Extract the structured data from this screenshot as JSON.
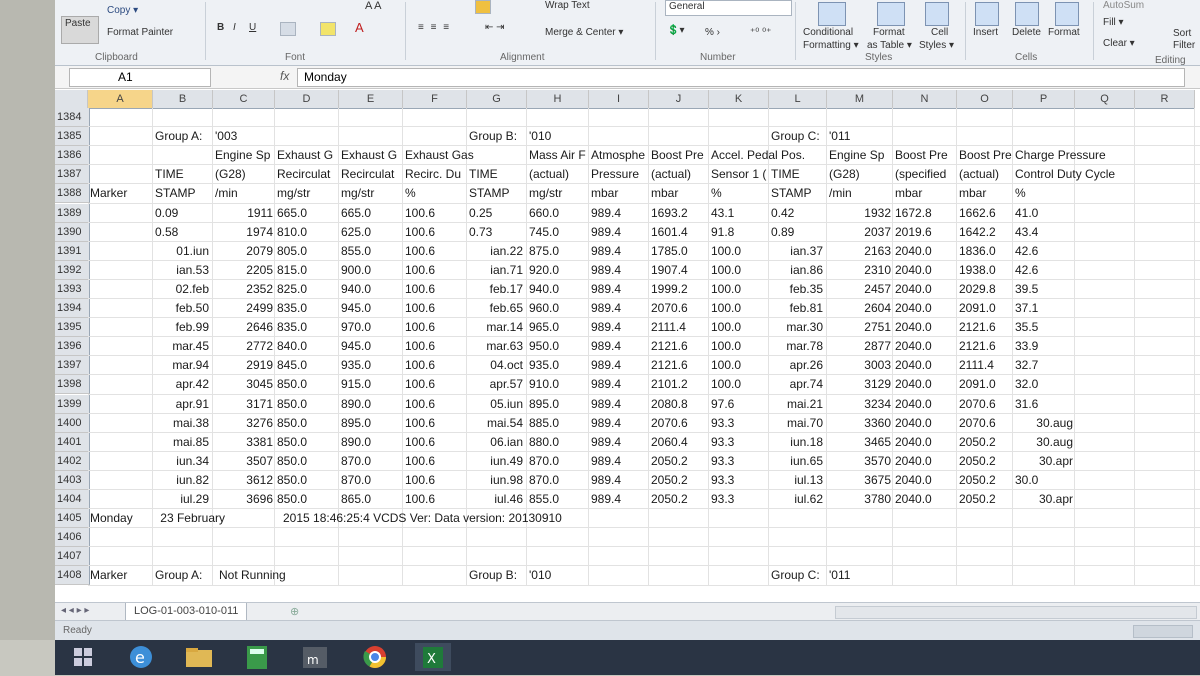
{
  "ribbon": {
    "paste": "Paste",
    "copy": "Copy ▾",
    "format_painter": "Format Painter",
    "clipboard": "Clipboard",
    "font": "Font",
    "alignment": "Alignment",
    "number": "Number",
    "styles": "Styles",
    "cells": "Cells",
    "editing": "Editing",
    "wrap_text": "Wrap Text",
    "merge_center": "Merge & Center ▾",
    "number_format": "General",
    "percent": "% ›",
    "conditional": "Conditional",
    "formatting": "Formatting ▾",
    "format_as": "Format",
    "as_table": "as Table ▾",
    "cell": "Cell",
    "cell_styles": "Styles ▾",
    "insert": "Insert",
    "delete": "Delete",
    "format": "Format",
    "fill": "Fill ▾",
    "clear": "Clear ▾",
    "sort": "Sort",
    "filter": "Filter",
    "autosum": "AutoSum"
  },
  "formula_bar": {
    "name_box": "A1",
    "fx": "fx",
    "value": "Monday"
  },
  "columns": [
    "A",
    "B",
    "C",
    "D",
    "E",
    "F",
    "G",
    "H",
    "I",
    "J",
    "K",
    "L",
    "M",
    "N",
    "O",
    "P",
    "Q",
    "R"
  ],
  "row_numbers": [
    "1384",
    "1385",
    "1386",
    "1387",
    "1388",
    "1389",
    "1390",
    "1391",
    "1392",
    "1393",
    "1394",
    "1395",
    "1396",
    "1397",
    "1398",
    "1399",
    "1400",
    "1401",
    "1402",
    "1403",
    "1404",
    "1405",
    "1406",
    "1407",
    "1408"
  ],
  "group_rows": {
    "groupA": "Group A:",
    "groupA_code": "'003",
    "groupB": "Group B:",
    "groupB_code": "'010",
    "groupC": "Group C:",
    "groupC_code": "'011"
  },
  "headers_1386": [
    "Engine Sp",
    "Exhaust G",
    "Exhaust G",
    "Exhaust Gas",
    "Mass Air F",
    "Atmosphe",
    "Boost Pre",
    "Accel. Pedal Pos.",
    "Engine Sp",
    "Boost Pre",
    "Boost Pre",
    "Charge Pressure"
  ],
  "headers_1387": [
    "TIME",
    "(G28)",
    "Recirculat",
    "Recirculat",
    "Recirc. Du",
    "TIME",
    "(actual)",
    "Pressure",
    "(actual)",
    "Sensor 1 (",
    "TIME",
    "(G28)",
    "(specified",
    "(actual)",
    "Control Duty Cycle"
  ],
  "headers_1388": [
    "Marker",
    "STAMP",
    "/min",
    "mg/str",
    "mg/str",
    "%",
    "STAMP",
    "mg/str",
    "mbar",
    "mbar",
    "%",
    "STAMP",
    "/min",
    "mbar",
    "mbar",
    "%"
  ],
  "data_rows": [
    [
      "0.09",
      "1911",
      "665.0",
      "665.0",
      "100.6",
      "0.25",
      "660.0",
      "989.4",
      "1693.2",
      "43.1",
      "0.42",
      "1932",
      "1672.8",
      "1662.6",
      "41.0"
    ],
    [
      "0.58",
      "1974",
      "810.0",
      "625.0",
      "100.6",
      "0.73",
      "745.0",
      "989.4",
      "1601.4",
      "91.8",
      "0.89",
      "2037",
      "2019.6",
      "1642.2",
      "43.4"
    ],
    [
      "01.iun",
      "2079",
      "805.0",
      "855.0",
      "100.6",
      "ian.22",
      "875.0",
      "989.4",
      "1785.0",
      "100.0",
      "ian.37",
      "2163",
      "2040.0",
      "1836.0",
      "42.6"
    ],
    [
      "ian.53",
      "2205",
      "815.0",
      "900.0",
      "100.6",
      "ian.71",
      "920.0",
      "989.4",
      "1907.4",
      "100.0",
      "ian.86",
      "2310",
      "2040.0",
      "1938.0",
      "42.6"
    ],
    [
      "02.feb",
      "2352",
      "825.0",
      "940.0",
      "100.6",
      "feb.17",
      "940.0",
      "989.4",
      "1999.2",
      "100.0",
      "feb.35",
      "2457",
      "2040.0",
      "2029.8",
      "39.5"
    ],
    [
      "feb.50",
      "2499",
      "835.0",
      "945.0",
      "100.6",
      "feb.65",
      "960.0",
      "989.4",
      "2070.6",
      "100.0",
      "feb.81",
      "2604",
      "2040.0",
      "2091.0",
      "37.1"
    ],
    [
      "feb.99",
      "2646",
      "835.0",
      "970.0",
      "100.6",
      "mar.14",
      "965.0",
      "989.4",
      "2111.4",
      "100.0",
      "mar.30",
      "2751",
      "2040.0",
      "2121.6",
      "35.5"
    ],
    [
      "mar.45",
      "2772",
      "840.0",
      "945.0",
      "100.6",
      "mar.63",
      "950.0",
      "989.4",
      "2121.6",
      "100.0",
      "mar.78",
      "2877",
      "2040.0",
      "2121.6",
      "33.9"
    ],
    [
      "mar.94",
      "2919",
      "845.0",
      "935.0",
      "100.6",
      "04.oct",
      "935.0",
      "989.4",
      "2121.6",
      "100.0",
      "apr.26",
      "3003",
      "2040.0",
      "2111.4",
      "32.7"
    ],
    [
      "apr.42",
      "3045",
      "850.0",
      "915.0",
      "100.6",
      "apr.57",
      "910.0",
      "989.4",
      "2101.2",
      "100.0",
      "apr.74",
      "3129",
      "2040.0",
      "2091.0",
      "32.0"
    ],
    [
      "apr.91",
      "3171",
      "850.0",
      "890.0",
      "100.6",
      "05.iun",
      "895.0",
      "989.4",
      "2080.8",
      "97.6",
      "mai.21",
      "3234",
      "2040.0",
      "2070.6",
      "31.6"
    ],
    [
      "mai.38",
      "3276",
      "850.0",
      "895.0",
      "100.6",
      "mai.54",
      "885.0",
      "989.4",
      "2070.6",
      "93.3",
      "mai.70",
      "3360",
      "2040.0",
      "2070.6",
      "30.aug"
    ],
    [
      "mai.85",
      "3381",
      "850.0",
      "890.0",
      "100.6",
      "06.ian",
      "880.0",
      "989.4",
      "2060.4",
      "93.3",
      "iun.18",
      "3465",
      "2040.0",
      "2050.2",
      "30.aug"
    ],
    [
      "iun.34",
      "3507",
      "850.0",
      "870.0",
      "100.6",
      "iun.49",
      "870.0",
      "989.4",
      "2050.2",
      "93.3",
      "iun.65",
      "3570",
      "2040.0",
      "2050.2",
      "30.apr"
    ],
    [
      "iun.82",
      "3612",
      "850.0",
      "870.0",
      "100.6",
      "iun.98",
      "870.0",
      "989.4",
      "2050.2",
      "93.3",
      "iul.13",
      "3675",
      "2040.0",
      "2050.2",
      "30.0"
    ],
    [
      "iul.29",
      "3696",
      "850.0",
      "865.0",
      "100.6",
      "iul.46",
      "855.0",
      "989.4",
      "2050.2",
      "93.3",
      "iul.62",
      "3780",
      "2040.0",
      "2050.2",
      "30.apr"
    ]
  ],
  "row_1405": {
    "a": "Monday",
    "b": "23 February",
    "c": "2015 18:46:25:4 VCDS Ver: Data version: 20130910"
  },
  "row_1408": {
    "a": "Marker",
    "b": "Group A:",
    "c": "Not Running",
    "g": "Group B:",
    "h": "'010",
    "l": "Group C:",
    "m": "'011"
  },
  "sheet_tab": "LOG-01-003-010-011",
  "status": "Ready",
  "colors": {
    "ribbon_bg": "#eef1f5",
    "header_bg": "#dfe3e8",
    "taskbar": "#2a3444",
    "accent_excel": "#1f7a3a"
  }
}
